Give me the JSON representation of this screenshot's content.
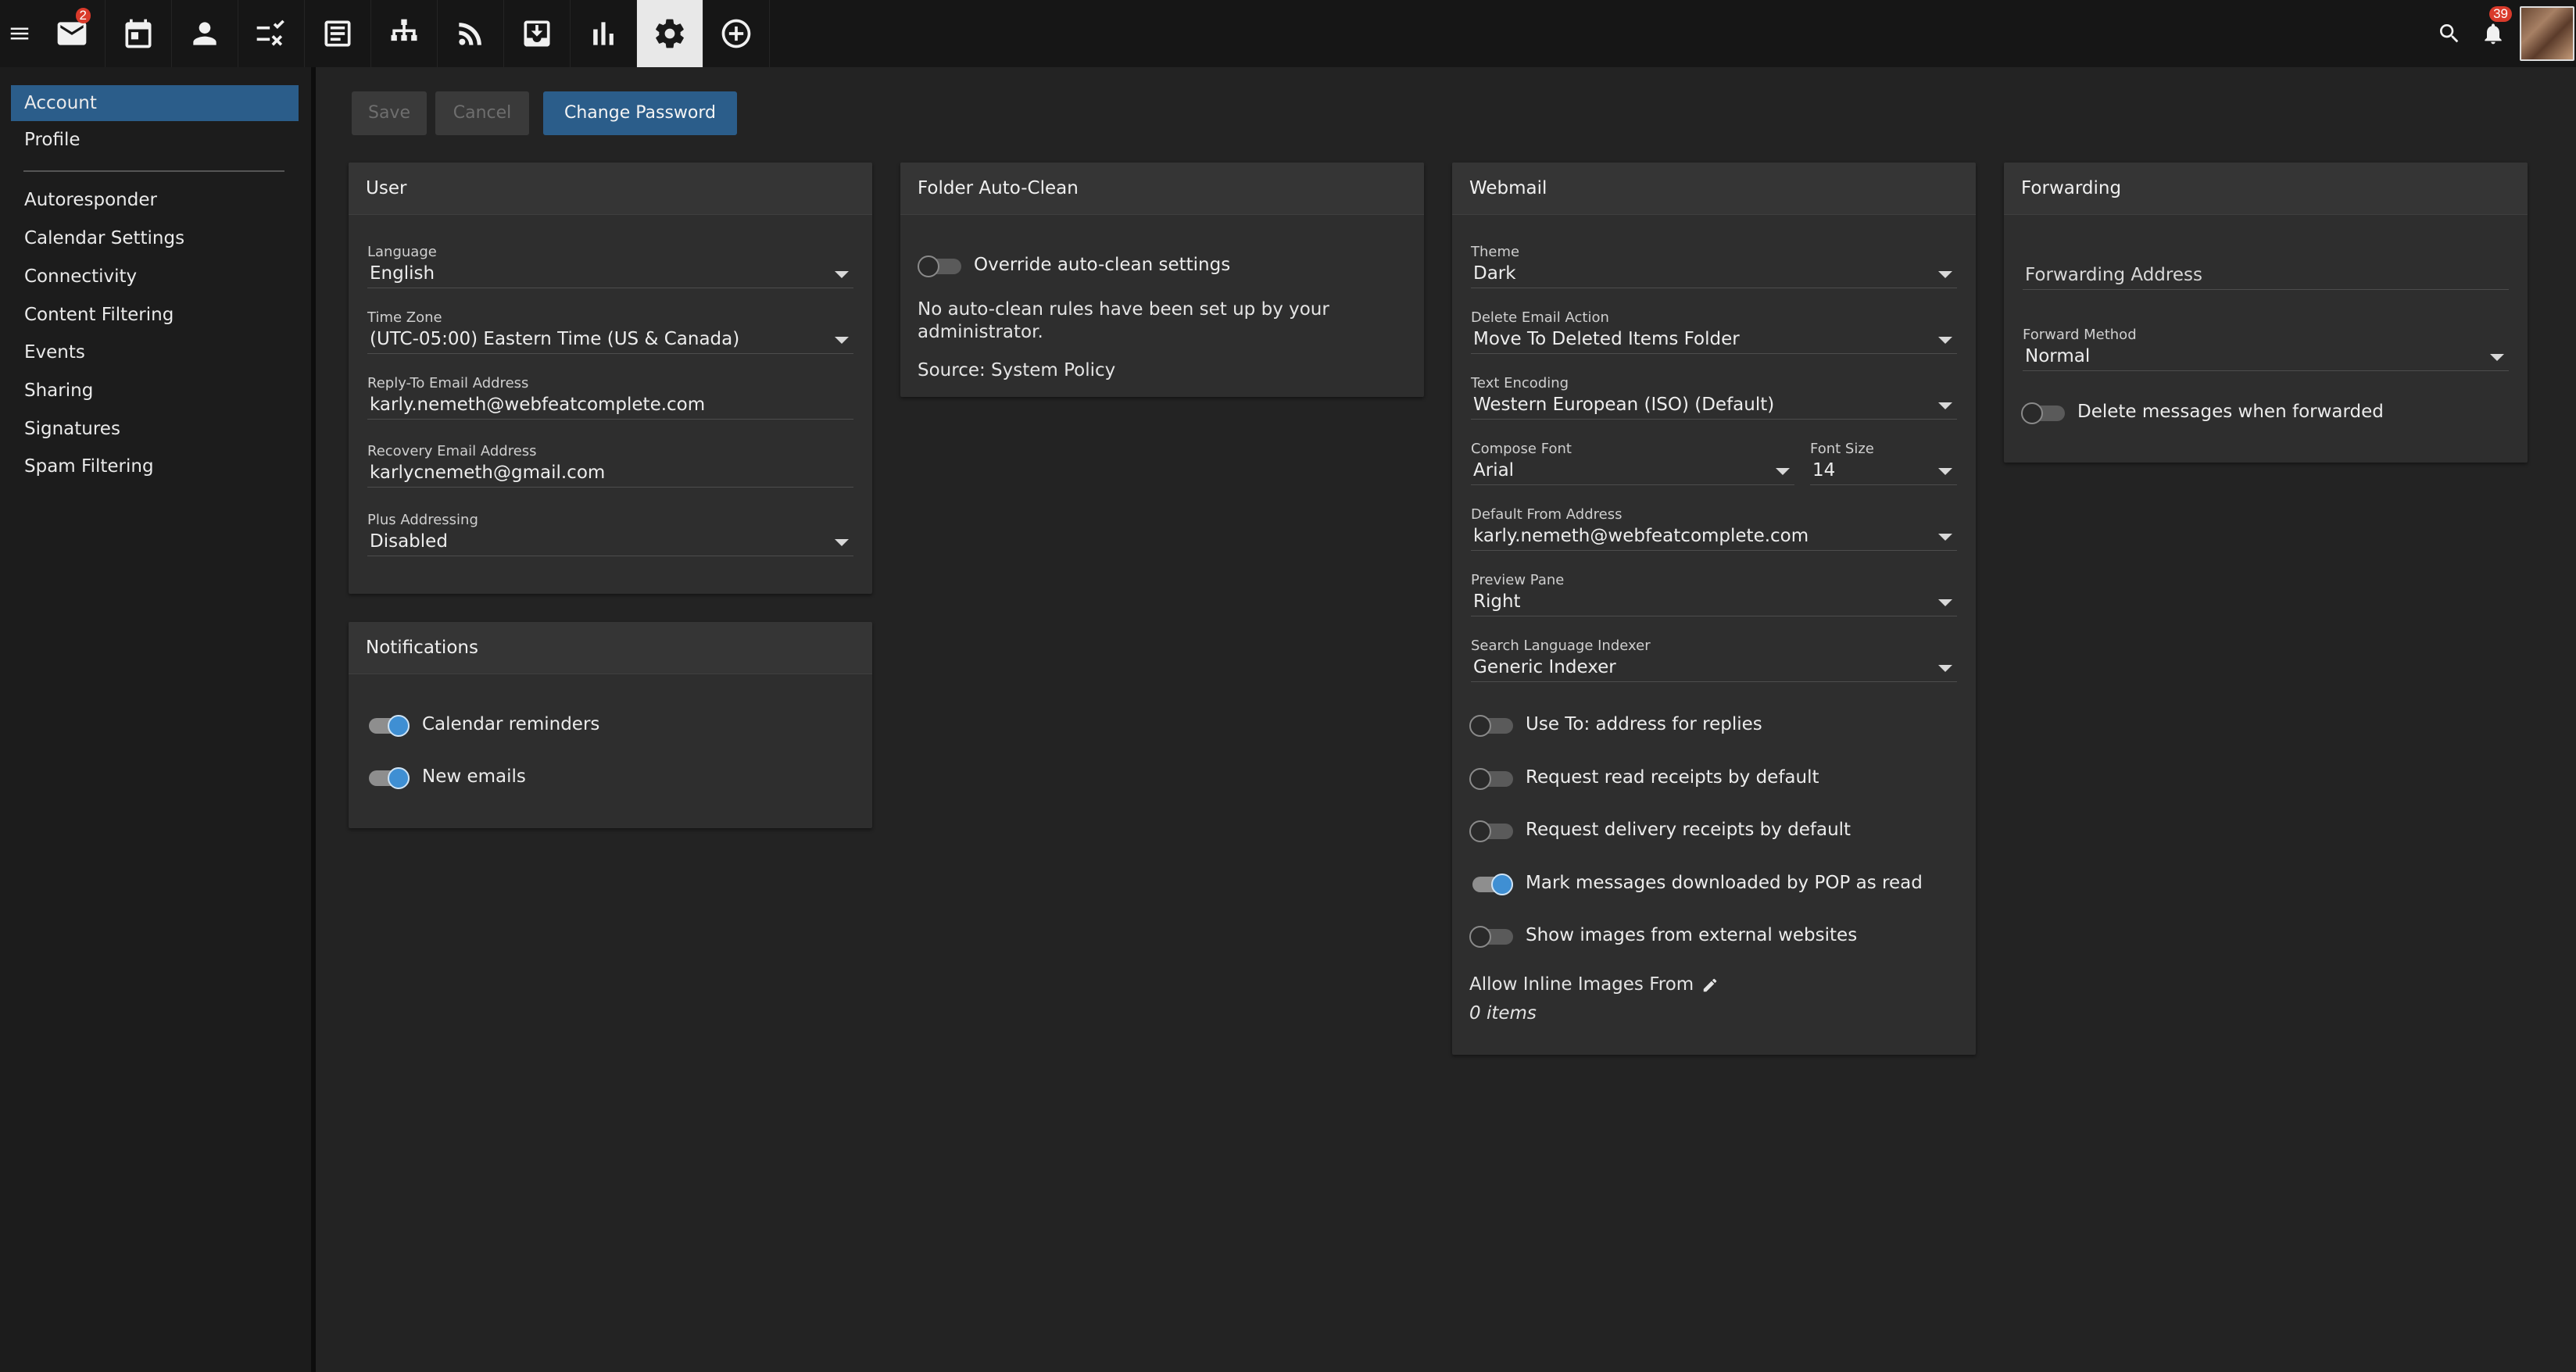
{
  "topbar": {
    "mail_badge": "2",
    "notifications_badge": "39",
    "apps": [
      "mail",
      "calendar",
      "contacts",
      "tasks",
      "notes",
      "sitemap",
      "rss",
      "archive",
      "reports",
      "settings",
      "add"
    ]
  },
  "sidebar": {
    "items": [
      "Account",
      "Profile",
      "Autoresponder",
      "Calendar Settings",
      "Connectivity",
      "Content Filtering",
      "Events",
      "Sharing",
      "Signatures",
      "Spam Filtering"
    ],
    "active": "Account"
  },
  "toolbar": {
    "save": "Save",
    "cancel": "Cancel",
    "change_password": "Change Password"
  },
  "user": {
    "title": "User",
    "language_label": "Language",
    "language": "English",
    "timezone_label": "Time Zone",
    "timezone": "(UTC-05:00) Eastern Time (US & Canada)",
    "reply_to_label": "Reply-To Email Address",
    "reply_to": "karly.nemeth@webfeatcomplete.com",
    "recovery_label": "Recovery Email Address",
    "recovery": "karlycnemeth@gmail.com",
    "plus_label": "Plus Addressing",
    "plus": "Disabled"
  },
  "notifications": {
    "title": "Notifications",
    "calendar_reminders": "Calendar reminders",
    "new_emails": "New emails"
  },
  "autoclean": {
    "title": "Folder Auto-Clean",
    "override": "Override auto-clean settings",
    "message": "No auto-clean rules have been set up by your administrator.",
    "source": "Source: System Policy"
  },
  "webmail": {
    "title": "Webmail",
    "theme_label": "Theme",
    "theme": "Dark",
    "delete_label": "Delete Email Action",
    "delete": "Move To Deleted Items Folder",
    "encoding_label": "Text Encoding",
    "encoding": "Western European (ISO) (Default)",
    "font_label": "Compose Font",
    "font": "Arial",
    "size_label": "Font Size",
    "size": "14",
    "from_label": "Default From Address",
    "from": "karly.nemeth@webfeatcomplete.com",
    "preview_label": "Preview Pane",
    "preview": "Right",
    "indexer_label": "Search Language Indexer",
    "indexer": "Generic Indexer",
    "use_to": "Use To: address for replies",
    "read_receipts": "Request read receipts by default",
    "delivery_receipts": "Request delivery receipts by default",
    "mark_pop": "Mark messages downloaded by POP as read",
    "show_images": "Show images from external websites",
    "inline_label": "Allow Inline Images From",
    "inline_count": "0 items"
  },
  "forwarding": {
    "title": "Forwarding",
    "address_placeholder": "Forwarding Address",
    "method_label": "Forward Method",
    "method": "Normal",
    "delete_fwd": "Delete messages when forwarded"
  },
  "colors": {
    "accent": "#2b5d8a",
    "toggle_on": "#3f8fd3",
    "badge": "#d93a2b",
    "background": "#232323",
    "card": "#2e2e2e"
  },
  "toggles": {
    "override": false,
    "calendar_reminders": true,
    "new_emails": true,
    "use_to": false,
    "read_receipts": false,
    "delivery_receipts": false,
    "mark_pop": true,
    "show_images": false,
    "delete_fwd": false
  }
}
